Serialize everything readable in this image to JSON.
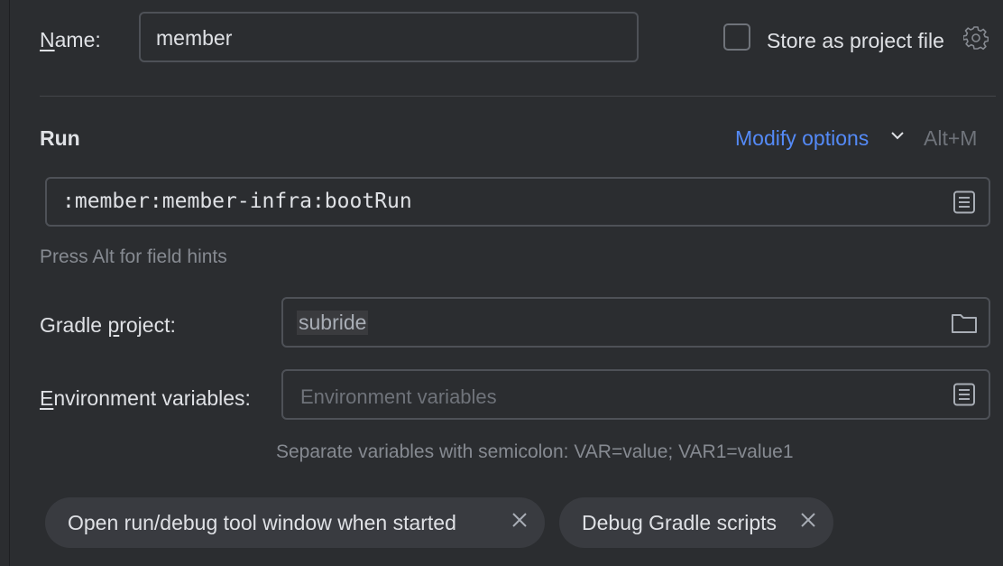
{
  "name": {
    "label_first": "N",
    "label_rest": "ame:",
    "value": "member"
  },
  "store_as_project_file": {
    "label": "Store as project file",
    "checked": false
  },
  "run_section": {
    "title": "Run",
    "modify_options": "Modify options",
    "shortcut": "Alt+M",
    "task_value": ":member:member-infra:bootRun",
    "field_hint": "Press Alt for field hints"
  },
  "gradle_project": {
    "label_pre": "Gradle ",
    "label_u": "p",
    "label_post": "roject:",
    "value": "subride"
  },
  "env_vars": {
    "label_u": "E",
    "label_rest": "nvironment variables:",
    "placeholder": "Environment variables",
    "hint": "Separate variables with semicolon: VAR=value; VAR1=value1"
  },
  "chips": [
    {
      "label": "Open run/debug tool window when started"
    },
    {
      "label": "Debug Gradle scripts"
    }
  ],
  "icons": {
    "settings": "gear-icon",
    "modify_chevron": "chevron-down-icon",
    "task_expand": "document-list-icon",
    "project_browse": "folder-icon",
    "env_expand": "document-list-icon",
    "chip_close": "close-icon"
  },
  "colors": {
    "background": "#2b2d30",
    "border": "#4e5157",
    "link": "#548af7",
    "muted": "#868a91",
    "chip": "#393b40"
  }
}
